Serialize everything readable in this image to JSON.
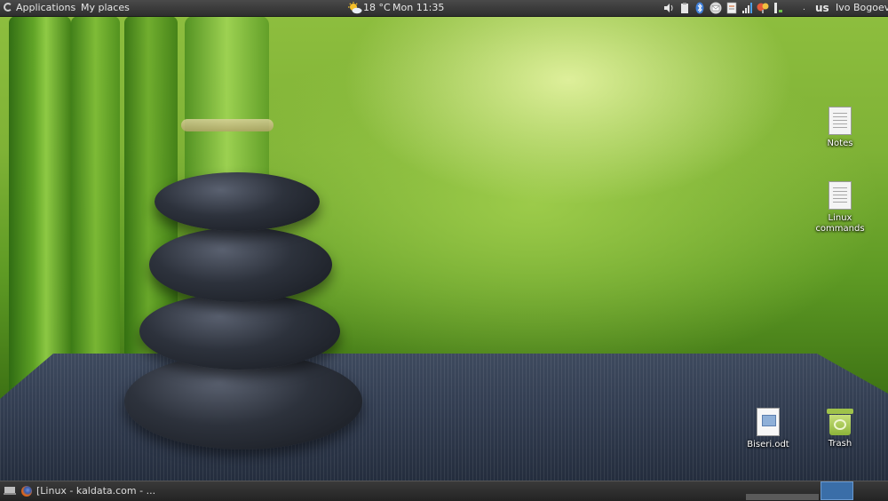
{
  "top_panel": {
    "applications_label": "Applications",
    "places_label": "My places",
    "weather_temp": "18 °C",
    "clock": "Mon 11:35",
    "keyboard_layout": "us",
    "user_name": "Ivo Bogoev",
    "tray_icons": [
      "volume-icon",
      "clipboard-icon",
      "bluetooth-icon",
      "mail-icon",
      "notes-icon",
      "network-signal-icon",
      "updates-icon",
      "battery-icon"
    ]
  },
  "desktop": {
    "icons": [
      {
        "name": "notes-file",
        "label": "Notes",
        "icon": "text-document-icon"
      },
      {
        "name": "linux-commands-file",
        "label": "Linux\ncommands",
        "icon": "text-document-icon"
      },
      {
        "name": "biseri-odt-file",
        "label": "Biseri.odt",
        "icon": "odt-document-icon"
      },
      {
        "name": "trash",
        "label": "Trash",
        "icon": "trash-icon"
      }
    ]
  },
  "bottom_panel": {
    "task_label": "[Linux - kaldata.com - ...",
    "colors": {
      "active_workspace": "#3a6ea8"
    }
  }
}
